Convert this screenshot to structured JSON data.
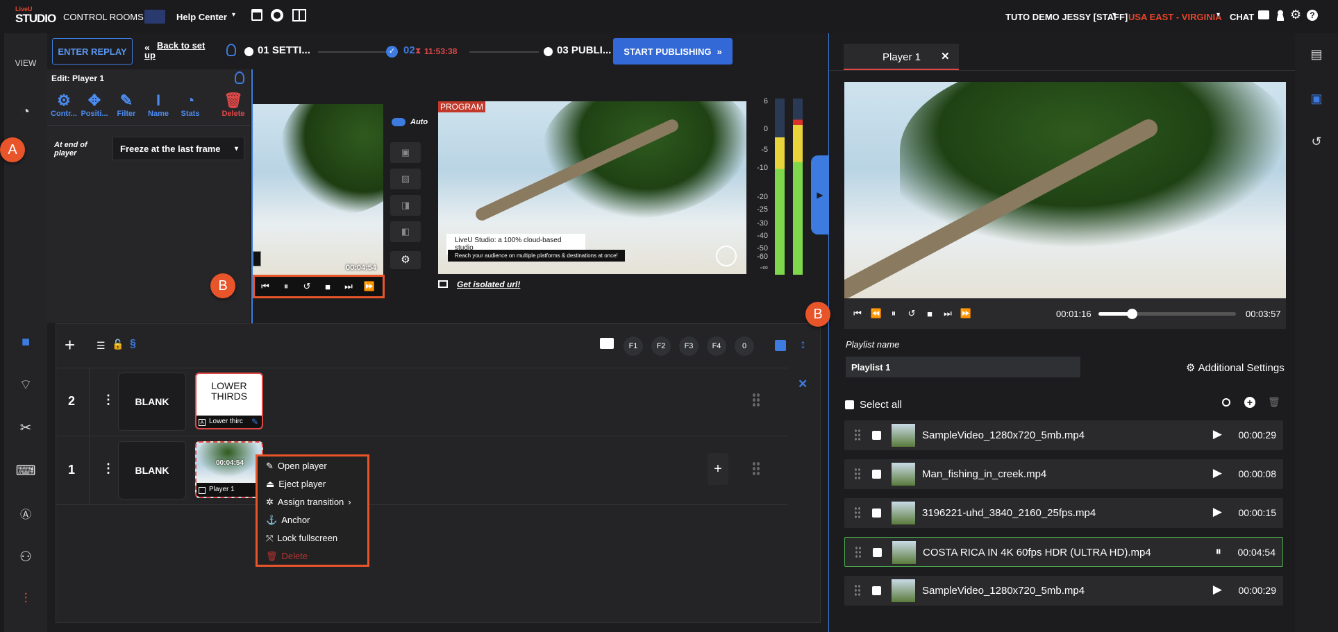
{
  "topbar": {
    "logo_small": "LiveU",
    "logo_big": "STUDIO",
    "control_rooms": "CONTROL ROOMS",
    "help_center": "Help Center",
    "user": "TUTO DEMO JESSY [STAFF]",
    "region": "USA EAST - VIRGINIA",
    "chat": "CHAT"
  },
  "leftnav": {
    "view": "VIEW"
  },
  "workflow": {
    "enter_replay": "ENTER REPLAY",
    "back_to_setup": "Back to set up",
    "step1": "01 SETTI...",
    "step2": "02",
    "timer": "11:53:38",
    "step3": "03 PUBLI...",
    "start_publishing": "START PUBLISHING"
  },
  "edit_panel": {
    "title": "Edit: Player 1",
    "tools": [
      "Contr...",
      "Positi...",
      "Filter",
      "Name",
      "Stats",
      "Delete"
    ],
    "end_label": "At end of player",
    "end_value": "Freeze at the last frame"
  },
  "callouts": {
    "a": "A",
    "b": "B"
  },
  "preview": {
    "timecode": "00:04:54",
    "auto_label": "Auto",
    "program_label": "PROGRAM",
    "overlay_title": "LiveU Studio: a 100% cloud-based studio",
    "overlay_sub": "Reach your audience on multiple platforms & destinations at once!",
    "isolated_url": "Get isolated url!",
    "meter_scale": [
      "6",
      "0",
      "-5",
      "-10",
      "-20",
      "-25",
      "-30",
      "-40",
      "-50",
      "-60",
      "-∞"
    ]
  },
  "layers": {
    "fkeys": [
      "F1",
      "F2",
      "F3",
      "F4",
      "0"
    ],
    "row2_num": "2",
    "row1_num": "1",
    "blank": "BLANK",
    "lower_title": "LOWER THIRDS",
    "lower_label": "Lower thirc",
    "player_label": "Player 1",
    "player_time": "00:04:54"
  },
  "context_menu": {
    "items": [
      "Open player",
      "Eject player",
      "Assign transition",
      "Anchor",
      "Lock fullscreen",
      "Delete"
    ]
  },
  "player": {
    "tab": "Player 1",
    "current_time": "00:01:16",
    "total_time": "00:03:57",
    "progress": 0.24,
    "playlist_name_label": "Playlist name",
    "playlist_name": "Playlist 1",
    "additional_settings": "Additional Settings",
    "select_all": "Select all",
    "items": [
      {
        "name": "SampleVideo_1280x720_5mb.mp4",
        "duration": "00:00:29",
        "playing": false
      },
      {
        "name": "Man_fishing_in_creek.mp4",
        "duration": "00:00:08",
        "playing": false
      },
      {
        "name": "3196221-uhd_3840_2160_25fps.mp4",
        "duration": "00:00:15",
        "playing": false
      },
      {
        "name": "COSTA RICA IN 4K 60fps HDR (ULTRA HD).mp4",
        "duration": "00:04:54",
        "playing": true
      },
      {
        "name": "SampleVideo_1280x720_5mb.mp4",
        "duration": "00:00:29",
        "playing": false
      }
    ]
  },
  "colors": {
    "accent": "#3269d6",
    "orange": "#e8552a",
    "region": "#e8452a",
    "timer": "#e04848"
  }
}
